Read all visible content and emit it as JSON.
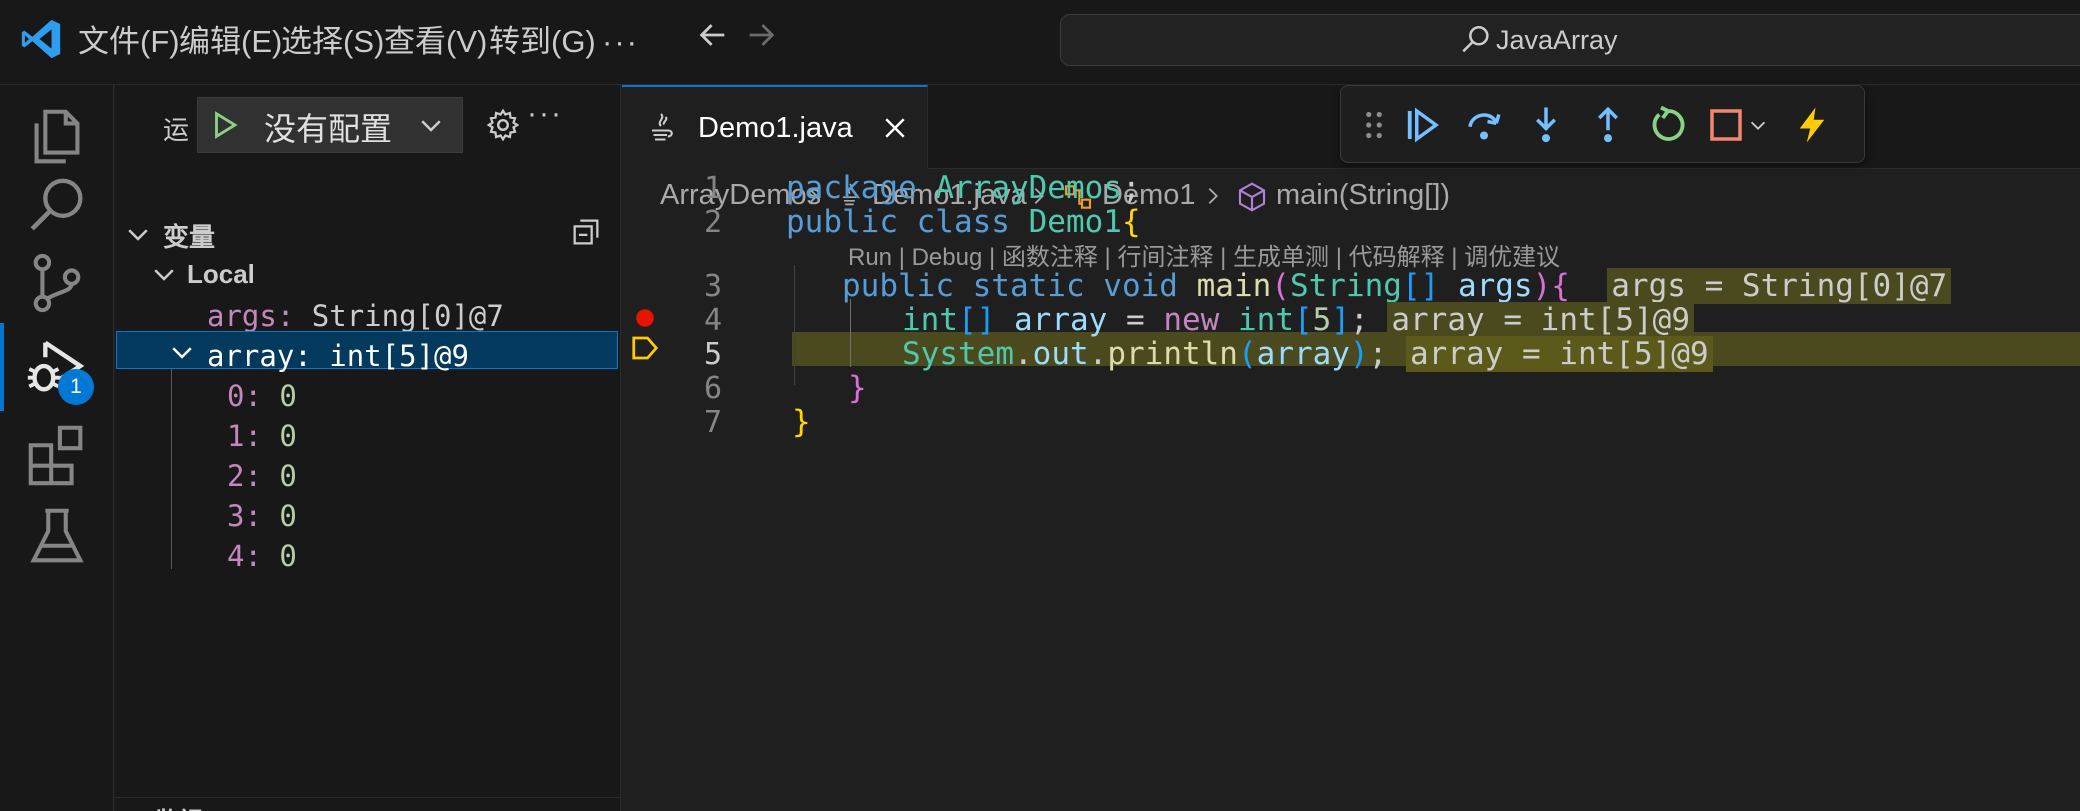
{
  "menu": [
    "文件(F)",
    "编辑(E)",
    "选择(S)",
    "查看(V)",
    "转到(G)",
    "···"
  ],
  "search": {
    "text": "JavaArray"
  },
  "activity": {
    "debug_badge": "1"
  },
  "sidebar": {
    "run_label": "运",
    "config": "没有配置",
    "variables_title": "变量",
    "scope": "Local",
    "vars": [
      {
        "name": "args:",
        "value": "String[0]@7"
      },
      {
        "name": "array:",
        "value": "int[5]@9"
      }
    ],
    "array_items": [
      {
        "idx": "0:",
        "val": "0"
      },
      {
        "idx": "1:",
        "val": "0"
      },
      {
        "idx": "2:",
        "val": "0"
      },
      {
        "idx": "3:",
        "val": "0"
      },
      {
        "idx": "4:",
        "val": "0"
      }
    ],
    "bottom_section": "监视"
  },
  "tab": {
    "label": "Demo1.java"
  },
  "breadcrumb": [
    "ArrayDemos",
    "Demo1.java",
    "Demo1",
    "main(String[])"
  ],
  "codelens": "Run | Debug | 函数注释 | 行间注释 | 生成单测 | 代码解释 | 调优建议",
  "line_numbers": [
    "1",
    "2",
    "3",
    "4",
    "5",
    "6",
    "7"
  ],
  "code": {
    "l1_kw": "package",
    "l1_pkg": "ArrayDemos",
    "l1_semi": ";",
    "l2_kw": "public class",
    "l2_cls": "Demo1",
    "l2_br": "{",
    "l3_kw": "public static void",
    "l3_fn": "main",
    "l3_p1": "(",
    "l3_ty": "String",
    "l3_arr": "[]",
    "l3_arg": "args",
    "l3_p2": ")",
    "l3_br": "{",
    "l3_inline": "args = String[0]@7",
    "l4_ty": "int",
    "l4_arr": "[]",
    "l4_var": "array",
    "l4_eq": " = ",
    "l4_new": "new",
    "l4_ty2": "int",
    "l4_b1": "[",
    "l4_num": "5",
    "l4_b2": "]",
    "l4_semi": ";",
    "l4_inline": "array = int[5]@9",
    "l5_sys": "System",
    "l5_dot1": ".",
    "l5_out": "out",
    "l5_dot2": ".",
    "l5_fn": "println",
    "l5_p1": "(",
    "l5_arg": "array",
    "l5_p2": ")",
    "l5_semi": ";",
    "l5_inline": "array = int[5]@9",
    "l6_br": "}",
    "l7_br": "}"
  },
  "colors": {
    "accent": "#0078d4",
    "breakpoint": "#e51400",
    "current_line": "#4b4a1e",
    "debug_icon_blue": "#75beff",
    "debug_icon_green": "#89d185",
    "debug_icon_stop": "#f48771",
    "debug_icon_hot": "#ffcc00"
  }
}
